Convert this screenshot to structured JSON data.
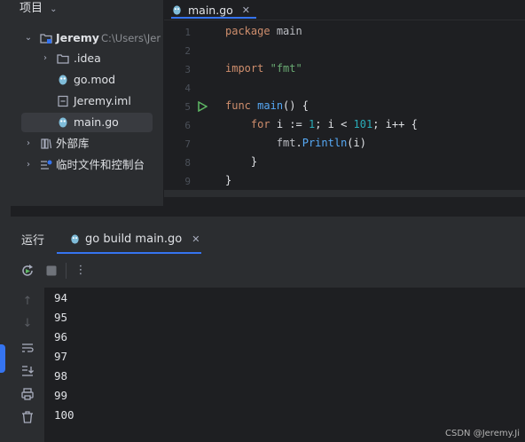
{
  "project": {
    "title": "项目",
    "items": [
      {
        "label": "Jeremy",
        "path": "C:\\Users\\Jer"
      },
      {
        "label": ".idea"
      },
      {
        "label": "go.mod"
      },
      {
        "label": "Jeremy.iml"
      },
      {
        "label": "main.go"
      },
      {
        "label": "外部库"
      },
      {
        "label": "临时文件和控制台"
      }
    ]
  },
  "editor": {
    "tab": "main.go",
    "line_numbers": [
      "1",
      "2",
      "3",
      "4",
      "5",
      "6",
      "7",
      "8",
      "9"
    ]
  },
  "run": {
    "title": "运行",
    "tab": "go build main.go",
    "output": [
      "94",
      "95",
      "96",
      "97",
      "98",
      "99",
      "100"
    ]
  },
  "colors": {
    "accent": "#3574f0",
    "run_green": "#5fb865"
  },
  "watermark": "CSDN @Jeremy.Ji"
}
